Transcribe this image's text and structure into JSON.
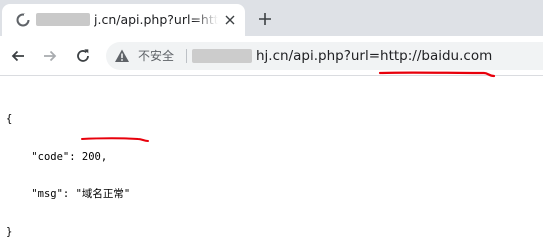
{
  "tab": {
    "title": "j.cn/api.php?url=htt",
    "favicon_icon": "globe-loading-icon",
    "close_icon": "close-icon"
  },
  "new_tab_icon": "plus-icon",
  "toolbar": {
    "back_icon": "back-arrow-icon",
    "forward_icon": "forward-arrow-icon",
    "reload_icon": "reload-icon"
  },
  "omnibox": {
    "security_icon": "warning-triangle-icon",
    "security_label": "不安全",
    "url_visible": "hj.cn/api.php?url=http://baidu.com"
  },
  "response": {
    "open_brace": "{",
    "code_key": "\"code\"",
    "code_value": "200,",
    "msg_key": "\"msg\"",
    "msg_value": "\"域名正常\"",
    "close_brace": "}"
  },
  "colors": {
    "tabbar_bg": "#dee1e6",
    "omnibox_bg": "#f1f3f4",
    "annotation_red": "#e8000b"
  }
}
